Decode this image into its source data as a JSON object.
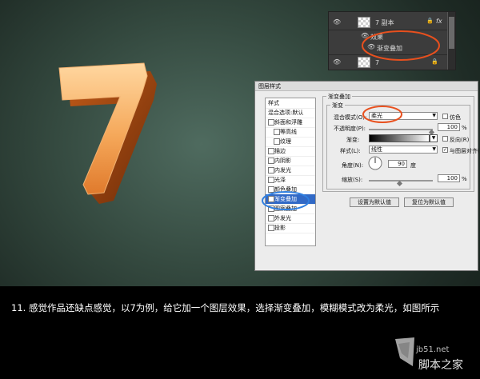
{
  "layers_panel": {
    "layer_top": {
      "name": "7 副本",
      "fx_label": "fx"
    },
    "effects_label": "效果",
    "effect_item": "渐变叠加",
    "layer_bottom": {
      "name": "7"
    }
  },
  "dialog": {
    "title": "图层样式",
    "styles": {
      "header": "样式",
      "items": [
        "混合选项:默认",
        "斜面和浮雕",
        "等高线",
        "纹理",
        "描边",
        "内阴影",
        "内发光",
        "光泽",
        "颜色叠加",
        "渐变叠加",
        "图案叠加",
        "外发光",
        "投影"
      ],
      "selected_index": 9
    },
    "gradient_overlay": {
      "group_title": "渐变叠加",
      "subgroup_title": "渐变",
      "blend_mode_label": "混合模式(O):",
      "blend_mode_value": "柔光",
      "dither_label": "仿色",
      "opacity_label": "不透明度(P):",
      "opacity_value": "100",
      "opacity_unit": "%",
      "gradient_label": "渐变:",
      "reverse_label": "反向(R)",
      "style_label": "样式(L):",
      "style_value": "线性",
      "align_label": "与图层对齐(I)",
      "angle_label": "角度(N):",
      "angle_value": "90",
      "angle_unit": "度",
      "scale_label": "缩放(S):",
      "scale_value": "100",
      "scale_unit": "%",
      "default_btn": "设置为默认值",
      "reset_btn": "复位为默认值"
    }
  },
  "artwork": {
    "glyph": "7"
  },
  "caption": "11. 感觉作品还缺点感觉，以7为例，给它加一个图层效果，选择渐变叠加，模糊模式改为柔光，如图所示",
  "watermark": {
    "url": "jb51.net",
    "name": "脚本之家"
  },
  "colors": {
    "accent_circle": "#e8501e",
    "highlight_blue": "#3169c6",
    "glyph_orange": "#f29a46"
  }
}
